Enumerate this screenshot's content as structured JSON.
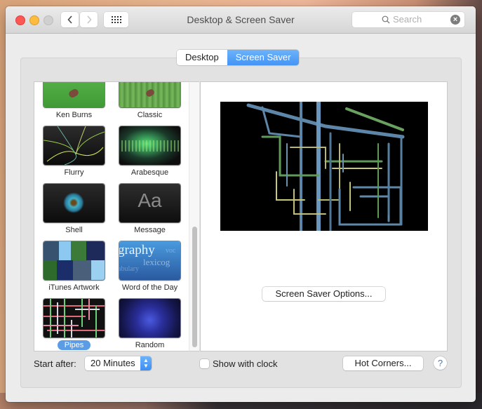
{
  "window": {
    "title": "Desktop & Screen Saver",
    "search_placeholder": "Search"
  },
  "tabs": [
    {
      "label": "Desktop",
      "active": false
    },
    {
      "label": "Screen Saver",
      "active": true
    }
  ],
  "screensavers": [
    {
      "name": "Ken Burns",
      "selected": false
    },
    {
      "name": "Classic",
      "selected": false
    },
    {
      "name": "Flurry",
      "selected": false
    },
    {
      "name": "Arabesque",
      "selected": false
    },
    {
      "name": "Shell",
      "selected": false
    },
    {
      "name": "Message",
      "selected": false
    },
    {
      "name": "iTunes Artwork",
      "selected": false
    },
    {
      "name": "Word of the Day",
      "selected": false
    },
    {
      "name": "Pipes",
      "selected": true
    },
    {
      "name": "Random",
      "selected": false
    }
  ],
  "thumb_text": {
    "message": "Aa",
    "word_of_day_1": "graphy",
    "word_of_day_2": "lexicog",
    "word_of_day_3": "abulary",
    "word_of_day_4": "voc"
  },
  "preview": {
    "options_label": "Screen Saver Options..."
  },
  "footer": {
    "start_after_label": "Start after:",
    "start_after_value": "20 Minutes",
    "show_clock_label": "Show with clock",
    "show_clock_checked": false,
    "hot_corners_label": "Hot Corners...",
    "help_label": "?"
  },
  "colors": {
    "accent": "#4594f5",
    "selection": "#5b9ce6"
  }
}
